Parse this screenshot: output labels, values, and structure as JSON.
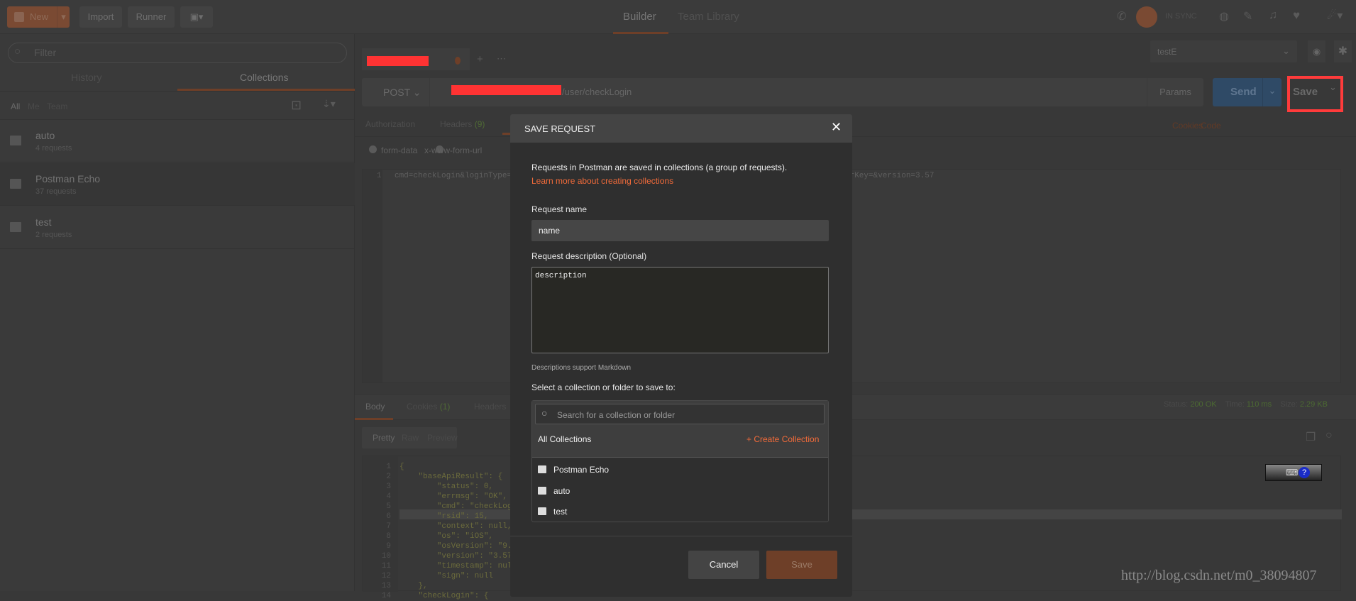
{
  "topbar": {
    "new": "New",
    "import": "Import",
    "runner": "Runner",
    "tabs": [
      "Builder",
      "Team Library"
    ],
    "sync": "IN SYNC"
  },
  "sidebar": {
    "filter_placeholder": "Filter",
    "tabs": [
      "History",
      "Collections"
    ],
    "filters": [
      "All",
      "Me",
      "Team"
    ],
    "collections": [
      {
        "name": "auto",
        "count": "4 requests"
      },
      {
        "name": "Postman Echo",
        "count": "37 requests"
      },
      {
        "name": "test",
        "count": "2 requests"
      }
    ]
  },
  "request": {
    "method": "POST",
    "url_suffix": "/user/checkLogin",
    "params": "Params",
    "send": "Send",
    "save": "Save",
    "environment": "testE",
    "subtabs": [
      {
        "label": "Authorization"
      },
      {
        "label": "Headers",
        "badge": "(9)"
      }
    ],
    "cookies": "Cookies",
    "code": "Code",
    "body_modes": [
      "form-data",
      "x-www-form-url"
    ],
    "body_line_no": "1",
    "body_text_a": "cmd=checkLogin&loginType=",
    "body_text_b": "erKey=&version=3.57"
  },
  "response": {
    "tabs": [
      {
        "label": "Body"
      },
      {
        "label": "Cookies",
        "badge": "(1)"
      },
      {
        "label": "Headers"
      }
    ],
    "status_label": "Status:",
    "status": "200 OK",
    "time_label": "Time:",
    "time": "110 ms",
    "size_label": "Size:",
    "size": "2.29 KB",
    "views": [
      "Pretty",
      "Raw",
      "Preview"
    ],
    "lines": [
      "{",
      "    \"baseApiResult\": {",
      "        \"status\": 0,",
      "        \"errmsg\": \"OK\",",
      "        \"cmd\": \"checkLog",
      "        \"rsid\": 15,",
      "        \"context\": null,",
      "        \"os\": \"iOS\",",
      "        \"osVersion\": \"9.",
      "        \"version\": \"3.57",
      "        \"timestamp\": nul",
      "        \"sign\": null",
      "    },",
      "    \"checkLogin\": {"
    ]
  },
  "modal": {
    "title": "SAVE REQUEST",
    "intro": "Requests in Postman are saved in collections (a group of requests).",
    "learn_link": "Learn more about creating collections",
    "name_label": "Request name",
    "name_value": "name",
    "desc_label": "Request description (Optional)",
    "desc_value": "description",
    "markdown_note": "Descriptions support Markdown",
    "select_label": "Select a collection or folder to save to:",
    "search_placeholder": "Search for a collection or folder",
    "all_collections": "All Collections",
    "create_collection": "+ Create Collection",
    "collections": [
      "Postman Echo",
      "auto",
      "test"
    ],
    "cancel": "Cancel",
    "save": "Save"
  },
  "watermark": "http://blog.csdn.net/m0_38094807",
  "colors": {
    "accent": "#f26b3a",
    "save_highlight": "#ff3b3b",
    "send": "#2f4a66"
  }
}
